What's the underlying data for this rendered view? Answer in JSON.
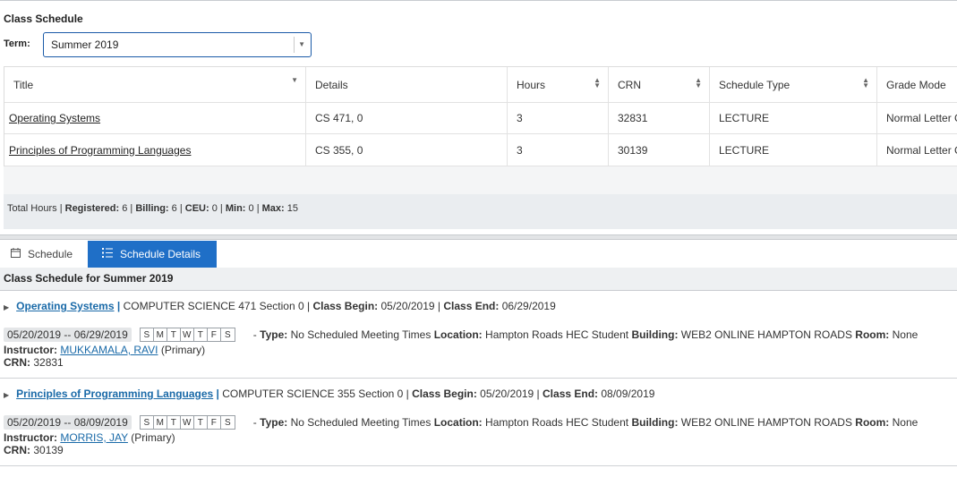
{
  "page_title": "Class Schedule",
  "term": {
    "label": "Term:",
    "value": "Summer 2019"
  },
  "table": {
    "headers": [
      "Title",
      "Details",
      "Hours",
      "CRN",
      "Schedule Type",
      "Grade Mode"
    ],
    "rows": [
      [
        "Operating Systems",
        "CS 471, 0",
        "3",
        "32831",
        "LECTURE",
        "Normal Letter G"
      ],
      [
        "Principles of Programming Languages",
        "CS 355, 0",
        "3",
        "30139",
        "LECTURE",
        "Normal Letter G"
      ]
    ]
  },
  "totals": {
    "label": "Total Hours",
    "registered_label": "Registered:",
    "registered": "6",
    "billing_label": "Billing:",
    "billing": "6",
    "ceu_label": "CEU:",
    "ceu": "0",
    "min_label": "Min:",
    "min": "0",
    "max_label": "Max:",
    "max": "15"
  },
  "tabs": [
    {
      "label": "Schedule",
      "icon": "calendar-icon"
    },
    {
      "label": "Schedule Details",
      "icon": "list-icon"
    }
  ],
  "details_title": "Class Schedule for Summer 2019",
  "courses": [
    {
      "title": "Operating Systems",
      "subject": "COMPUTER SCIENCE 471 Section 0",
      "class_begin_label": "Class Begin:",
      "class_begin": "05/20/2019",
      "class_end_label": "Class End:",
      "class_end": "06/29/2019",
      "date_range": "05/20/2019 -- 06/29/2019",
      "days": [
        "S",
        "M",
        "T",
        "W",
        "T",
        "F",
        "S"
      ],
      "type_label": "Type:",
      "type": "No Scheduled Meeting Times",
      "location_label": "Location:",
      "location": "Hampton Roads HEC Student",
      "building_label": "Building:",
      "building": "WEB2 ONLINE HAMPTON ROADS",
      "room_label": "Room:",
      "room": "None",
      "instructor_label": "Instructor:",
      "instructor": "MUKKAMALA, RAVI",
      "instructor_role": "(Primary)",
      "crn_label": "CRN:",
      "crn": "32831"
    },
    {
      "title": "Principles of Programming Languages",
      "subject": "COMPUTER SCIENCE 355 Section 0",
      "class_begin_label": "Class Begin:",
      "class_begin": "05/20/2019",
      "class_end_label": "Class End:",
      "class_end": "08/09/2019",
      "date_range": "05/20/2019 -- 08/09/2019",
      "days": [
        "S",
        "M",
        "T",
        "W",
        "T",
        "F",
        "S"
      ],
      "type_label": "Type:",
      "type": "No Scheduled Meeting Times",
      "location_label": "Location:",
      "location": "Hampton Roads HEC Student",
      "building_label": "Building:",
      "building": "WEB2 ONLINE HAMPTON ROADS",
      "room_label": "Room:",
      "room": "None",
      "instructor_label": "Instructor:",
      "instructor": "MORRIS, JAY",
      "instructor_role": "(Primary)",
      "crn_label": "CRN:",
      "crn": "30139"
    }
  ],
  "colors": {
    "accent": "#1f6fc7",
    "link": "#1a6aa8"
  }
}
